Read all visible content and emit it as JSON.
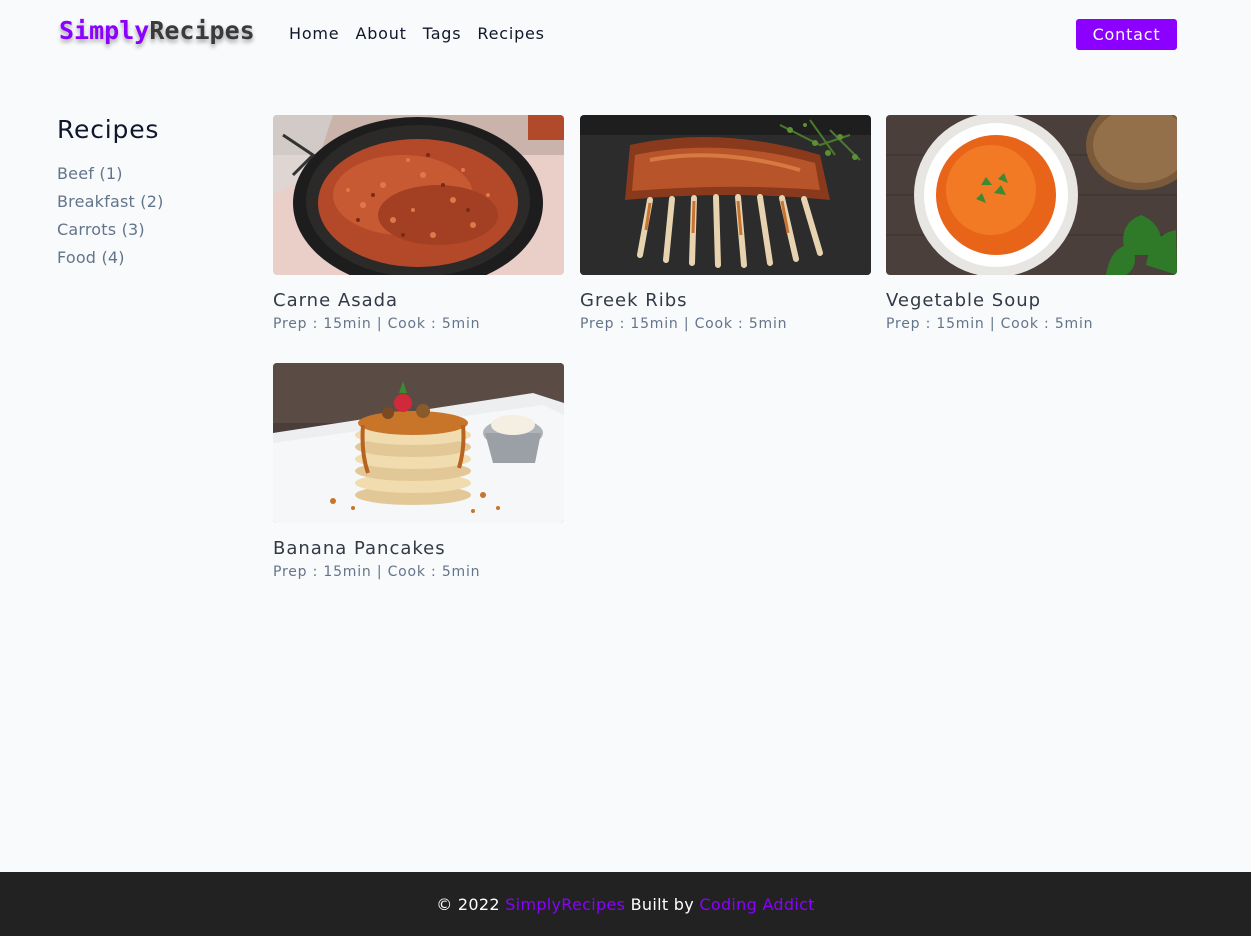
{
  "nav": {
    "logo_part1": "Simply",
    "logo_part2": "Recipes",
    "links": [
      "Home",
      "About",
      "Tags",
      "Recipes"
    ],
    "contact_label": "Contact",
    "accent_color": "#8b00ff"
  },
  "sidebar": {
    "title": "Recipes",
    "tags": [
      "Beef (1)",
      "Breakfast (2)",
      "Carrots (3)",
      "Food (4)"
    ]
  },
  "recipes": [
    {
      "title": "Carne Asada",
      "meta": "Prep : 15min | Cook : 5min",
      "image": "fried-meat-pan-photo"
    },
    {
      "title": "Greek Ribs",
      "meta": "Prep : 15min | Cook : 5min",
      "image": "grilled-ribs-photo"
    },
    {
      "title": "Vegetable Soup",
      "meta": "Prep : 15min | Cook : 5min",
      "image": "tomato-soup-bowl-photo"
    },
    {
      "title": "Banana Pancakes",
      "meta": "Prep : 15min | Cook : 5min",
      "image": "pancake-stack-photo"
    }
  ],
  "footer": {
    "copyright": "© 2022 ",
    "brand": "SimplyRecipes",
    "built_by": " Built by ",
    "author": "Coding Addict"
  }
}
